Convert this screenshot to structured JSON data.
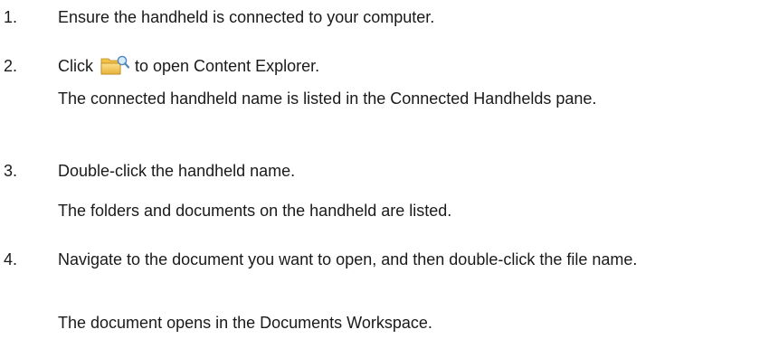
{
  "steps": [
    {
      "number": "1.",
      "text": "Ensure the handheld is connected to your computer."
    },
    {
      "number": "2.",
      "text_before": "Click",
      "icon": "content-explorer-folder-icon",
      "text_after": "to open Content Explorer.",
      "result": "The connected handheld name is listed in the Connected Handhelds pane."
    },
    {
      "number": "3.",
      "text": "Double-click the handheld name.",
      "result": "The folders and documents on the handheld are listed."
    },
    {
      "number": "4.",
      "text": "Navigate to the document you want to open, and then double-click the file name.",
      "result": "The document opens in the Documents Workspace."
    }
  ]
}
